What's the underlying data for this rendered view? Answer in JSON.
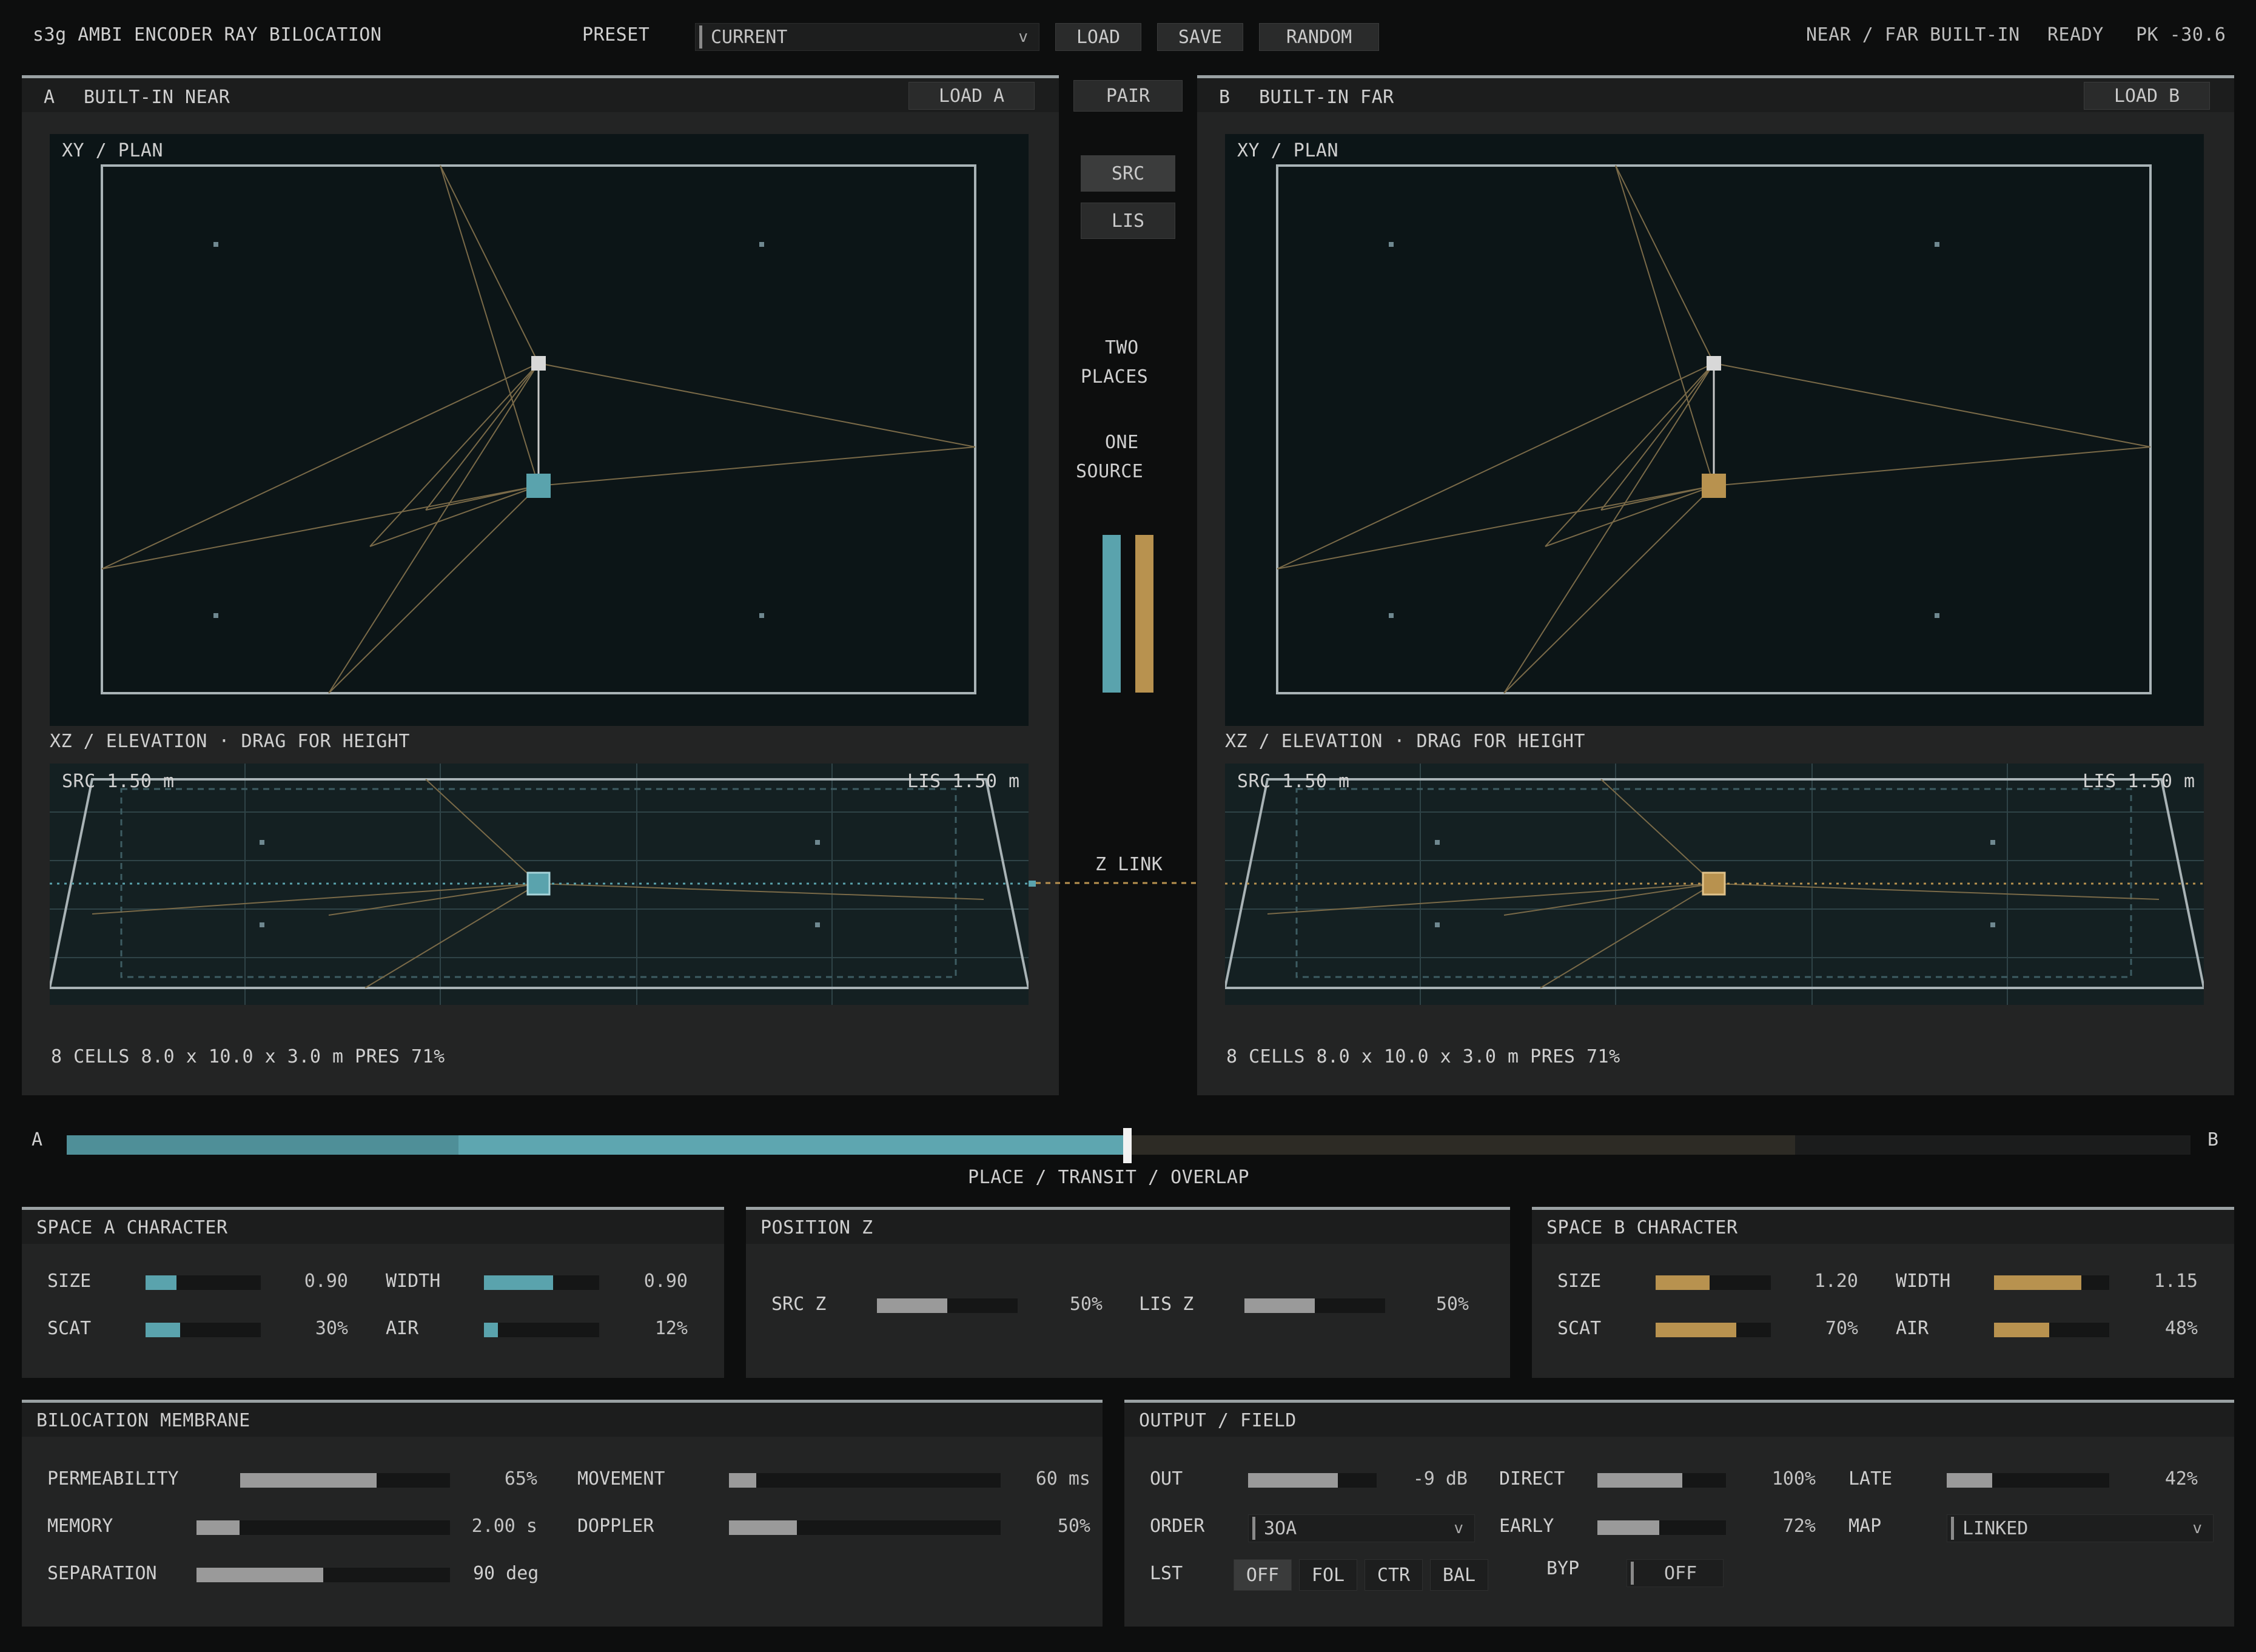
{
  "header": {
    "title": "s3g AMBI ENCODER RAY BILOCATION",
    "preset_label": "PRESET",
    "preset_value": "CURRENT",
    "load": "LOAD",
    "save": "SAVE",
    "random": "RANDOM",
    "mode": "NEAR / FAR BUILT-IN",
    "status": "READY",
    "peak": "PK -30.6"
  },
  "space_a": {
    "letter": "A",
    "name": "BUILT-IN NEAR",
    "load_btn": "LOAD A",
    "plan_label": "XY / PLAN",
    "elev_label": "XZ / ELEVATION  ·  DRAG FOR HEIGHT",
    "src_height": "SRC 1.50 m",
    "lis_height": "LIS 1.50 m",
    "footer": "8 CELLS  8.0 x 10.0 x 3.0 m  PRES 71%"
  },
  "space_b": {
    "letter": "B",
    "name": "BUILT-IN FAR",
    "load_btn": "LOAD B",
    "plan_label": "XY / PLAN",
    "elev_label": "XZ / ELEVATION  ·  DRAG FOR HEIGHT",
    "src_height": "SRC 1.50 m",
    "lis_height": "LIS 1.50 m",
    "footer": "8 CELLS  8.0 x 10.0 x 3.0 m  PRES 71%"
  },
  "center": {
    "pair": "PAIR",
    "src": "SRC",
    "lis": "LIS",
    "line1": "TWO",
    "line2": "PLACES",
    "line3": "ONE",
    "line4": "SOURCE",
    "zlink": "Z LINK"
  },
  "crossfade": {
    "left": "A",
    "right": "B",
    "caption": "PLACE / TRANSIT / OVERLAP",
    "position": 0.5
  },
  "space_a_char": {
    "title": "SPACE A CHARACTER",
    "size_label": "SIZE",
    "size_value": "0.90",
    "size_level": 0.27,
    "width_label": "WIDTH",
    "width_value": "0.90",
    "width_level": 0.6,
    "scat_label": "SCAT",
    "scat_value": "30%",
    "scat_level": 0.3,
    "air_label": "AIR",
    "air_value": "12%",
    "air_level": 0.12
  },
  "position_z": {
    "title": "POSITION Z",
    "src_label": "SRC Z",
    "src_value": "50%",
    "src_level": 0.5,
    "lis_label": "LIS Z",
    "lis_value": "50%",
    "lis_level": 0.5
  },
  "space_b_char": {
    "title": "SPACE B CHARACTER",
    "size_label": "SIZE",
    "size_value": "1.20",
    "size_level": 0.47,
    "width_label": "WIDTH",
    "width_value": "1.15",
    "width_level": 0.76,
    "scat_label": "SCAT",
    "scat_value": "70%",
    "scat_level": 0.7,
    "air_label": "AIR",
    "air_value": "48%",
    "air_level": 0.48
  },
  "membrane": {
    "title": "BILOCATION MEMBRANE",
    "permeability_label": "PERMEABILITY",
    "permeability_value": "65%",
    "permeability_level": 0.65,
    "movement_label": "MOVEMENT",
    "movement_value": "60 ms",
    "movement_level": 0.1,
    "memory_label": "MEMORY",
    "memory_value": "2.00 s",
    "memory_level": 0.17,
    "doppler_label": "DOPPLER",
    "doppler_value": "50%",
    "doppler_level": 0.25,
    "separation_label": "SEPARATION",
    "separation_value": "90 deg",
    "separation_level": 0.5
  },
  "output": {
    "title": "OUTPUT / FIELD",
    "out_label": "OUT",
    "out_value": "-9 dB",
    "out_level": 0.7,
    "direct_label": "DIRECT",
    "direct_value": "100%",
    "direct_level": 0.66,
    "late_label": "LATE",
    "late_value": "42%",
    "late_level": 0.28,
    "order_label": "ORDER",
    "order_value": "3OA",
    "early_label": "EARLY",
    "early_value": "72%",
    "early_level": 0.48,
    "map_label": "MAP",
    "map_value": "LINKED",
    "lst_label": "LST",
    "lst_options": [
      "OFF",
      "FOL",
      "CTR",
      "BAL"
    ],
    "lst_selected": "OFF",
    "byp_label": "BYP",
    "byp_value": "OFF"
  },
  "colors": {
    "accent_a": "#5aa3ad",
    "accent_b": "#b8924f",
    "ray": "#7a6a48",
    "background": "#0d0e0e"
  }
}
